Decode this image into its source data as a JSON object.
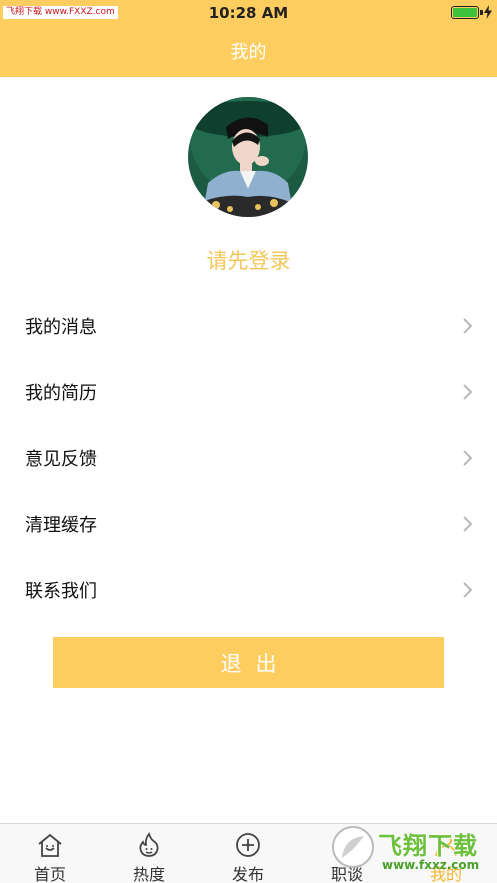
{
  "status_bar": {
    "watermark_badge": "飞翔下载 www.FXXZ.com",
    "time": "10:28 AM",
    "battery_color": "#3cc23c"
  },
  "header": {
    "title": "我的",
    "background": "#fdcd5f"
  },
  "profile": {
    "login_prompt": "请先登录"
  },
  "menu": [
    {
      "label": "我的消息",
      "icon": "chevron-right-icon"
    },
    {
      "label": "我的简历",
      "icon": "chevron-right-icon"
    },
    {
      "label": "意见反馈",
      "icon": "chevron-right-icon"
    },
    {
      "label": "清理缓存",
      "icon": "chevron-right-icon"
    },
    {
      "label": "联系我们",
      "icon": "chevron-right-icon"
    }
  ],
  "logout_label": "退出",
  "tabbar": {
    "tabs": [
      {
        "label": "首页",
        "icon": "home-icon"
      },
      {
        "label": "热度",
        "icon": "flame-icon"
      },
      {
        "label": "发布",
        "icon": "plus-circle-icon"
      },
      {
        "label": "职谈",
        "icon": "chat-icon"
      },
      {
        "label": "我的",
        "icon": "person-icon",
        "active": true
      }
    ],
    "active_color": "#f4b730"
  },
  "watermark": {
    "text": "飞翔下载",
    "url": "www.fxxz.com"
  }
}
